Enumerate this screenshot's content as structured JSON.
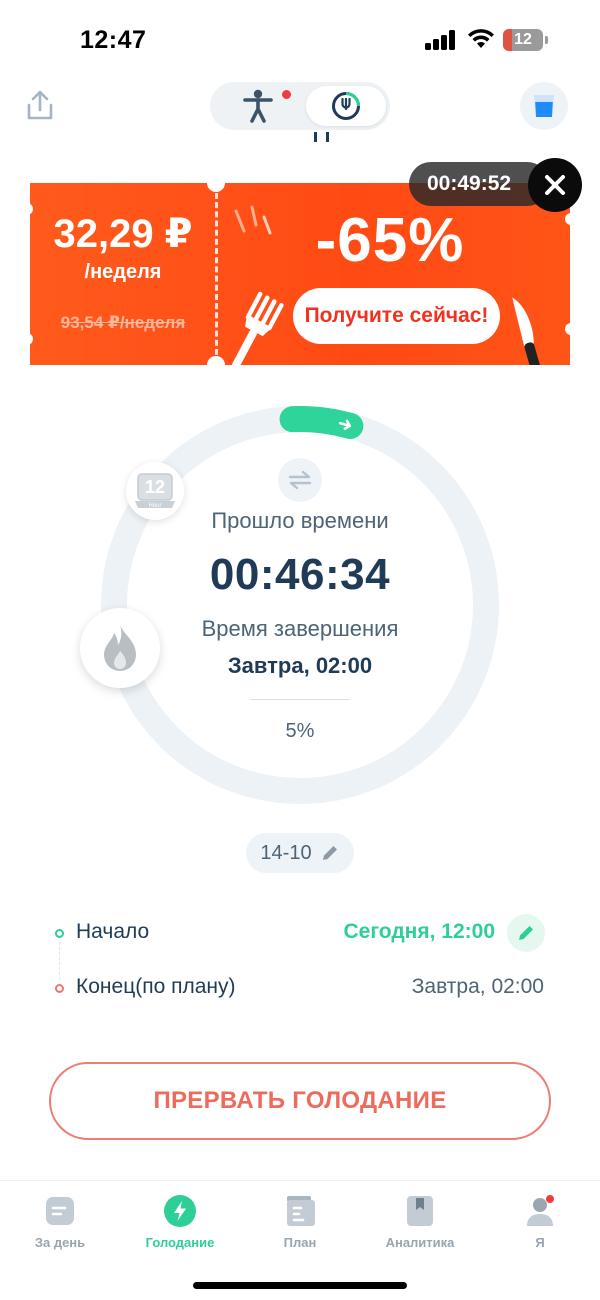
{
  "status_bar": {
    "time": "12:47",
    "battery": "12"
  },
  "top_bar": {
    "share_icon": "share-icon",
    "mode_toggle": {
      "body_icon": "body-icon",
      "fast_icon": "fasting-clock-icon"
    },
    "water_icon": "water-glass-icon"
  },
  "promo": {
    "price": "32,29 ₽",
    "period": "/неделя",
    "old_price": "93,54 ₽/неделя",
    "discount": "-65%",
    "cta": "Получите сейчас!",
    "countdown": "00:49:52"
  },
  "fasting": {
    "elapsed_label": "Прошло времени",
    "elapsed": "00:46:34",
    "end_label": "Время завершения",
    "end_time": "Завтра, 02:00",
    "percent_text": "5%",
    "progress": 0.05,
    "hour_badge": "12",
    "hour_badge_sub": "Hour"
  },
  "plan": {
    "label": "14-10"
  },
  "schedule": {
    "start_label": "Начало",
    "start_time": "Сегодня, 12:00",
    "end_label": "Конец(по плану)",
    "end_time": "Завтра, 02:00"
  },
  "stop_button": "ПРЕРВАТЬ ГОЛОДАНИЕ",
  "tabs": [
    {
      "label": "За день",
      "icon": "day-icon",
      "active": false
    },
    {
      "label": "Голодание",
      "icon": "fasting-bolt-icon",
      "active": true
    },
    {
      "label": "План",
      "icon": "plan-icon",
      "active": false
    },
    {
      "label": "Аналитика",
      "icon": "analytics-icon",
      "active": false
    },
    {
      "label": "Я",
      "icon": "profile-icon",
      "active": false
    }
  ],
  "colors": {
    "accent_green": "#2ecf96",
    "promo_orange": "#ff4a14",
    "stop_red": "#ee6a5c",
    "text_dark": "#1f3b57"
  }
}
